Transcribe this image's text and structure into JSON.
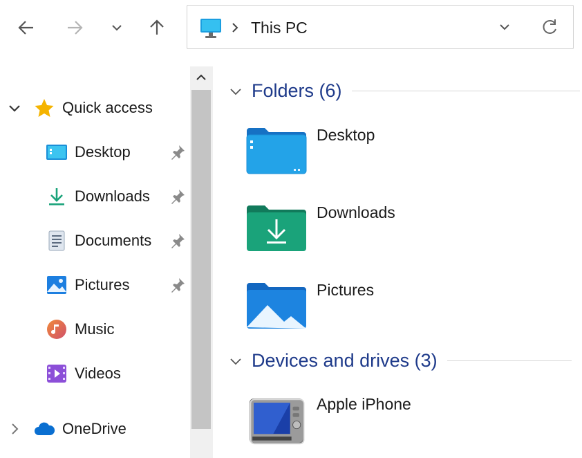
{
  "toolbar": {
    "back_icon": "arrow-left-icon",
    "forward_icon": "arrow-right-icon",
    "recent_icon": "chevron-down-icon",
    "up_icon": "arrow-up-icon"
  },
  "address": {
    "location_icon": "this-pc-icon",
    "path": "This PC"
  },
  "sidebar": {
    "quick_access": "Quick access",
    "items": [
      {
        "label": "Desktop",
        "icon": "desktop-icon",
        "pinned": true
      },
      {
        "label": "Downloads",
        "icon": "downloads-icon",
        "pinned": true
      },
      {
        "label": "Documents",
        "icon": "documents-icon",
        "pinned": true
      },
      {
        "label": "Pictures",
        "icon": "pictures-icon",
        "pinned": true
      },
      {
        "label": "Music",
        "icon": "music-icon",
        "pinned": false
      },
      {
        "label": "Videos",
        "icon": "videos-icon",
        "pinned": false
      }
    ],
    "onedrive": "OneDrive"
  },
  "main": {
    "folders_header": "Folders (6)",
    "folders": [
      {
        "name": "Desktop"
      },
      {
        "name": "Downloads"
      },
      {
        "name": "Pictures"
      }
    ],
    "devices_header": "Devices and drives (3)",
    "devices": [
      {
        "name": "Apple iPhone"
      }
    ]
  },
  "colors": {
    "accent": "#1e3a8a",
    "folder_blue": "#1a8fe0",
    "folder_green": "#1aa37a",
    "scroll_thumb": "#c4c4c4"
  }
}
